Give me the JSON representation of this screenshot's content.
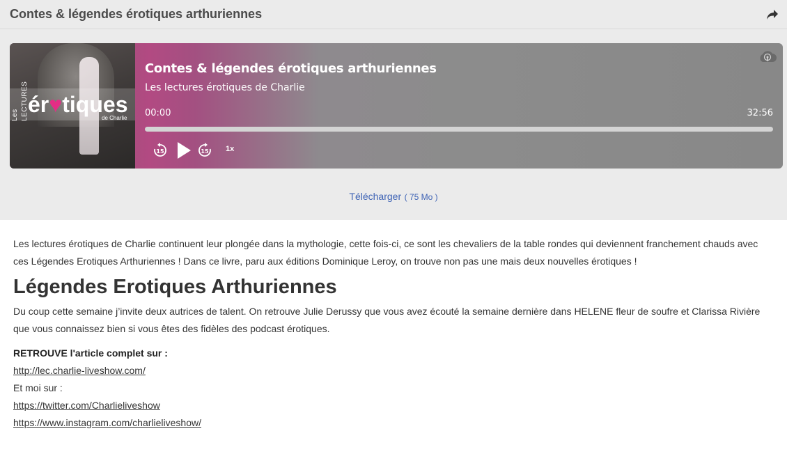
{
  "header": {
    "title": "Contes & légendes érotiques arthuriennes"
  },
  "player": {
    "cover_logo": {
      "les": "Les",
      "lectures": "LECTURES",
      "main_before": "ér",
      "main_heart": "♥",
      "main_after": "tiques",
      "sub": "de Charlie"
    },
    "episode_title": "Contes & légendes érotiques arthuriennes",
    "show_name": "Les lectures érotiques de Charlie",
    "current_time": "00:00",
    "total_time": "32:56",
    "progress_fraction": 0,
    "speed_label": "1x",
    "rewind_label": "15",
    "forward_label": "15"
  },
  "download": {
    "label": "Télécharger",
    "size": "( 75 Mo )"
  },
  "article": {
    "intro": "Les lectures érotiques de Charlie continuent leur plongée dans la mythologie, cette fois-ci, ce sont les chevaliers de la table rondes qui deviennent franchement chauds avec ces Légendes Erotiques Arthuriennes ! Dans ce livre, paru aux éditions Dominique Leroy, on trouve non pas une mais deux nouvelles érotiques !",
    "heading": "Légendes Erotiques Arthuriennes",
    "body": "Du coup cette semaine j’invite deux autrices de talent. On retrouve Julie Derussy que vous avez écouté la semaine dernière dans HELENE fleur de soufre et Clarissa Rivière que vous connaissez bien si vous êtes des fidèles des podcast érotiques.",
    "cta": "RETROUVE l'article complet sur :",
    "link1": "http://lec.charlie-liveshow.com/",
    "also": "Et moi sur :",
    "link2": "https://twitter.com/Charlieliveshow",
    "link3": "https://www.instagram.com/charlieliveshow/"
  },
  "colors": {
    "accent_pink": "#e52d85",
    "link_blue": "#3e63b5"
  }
}
